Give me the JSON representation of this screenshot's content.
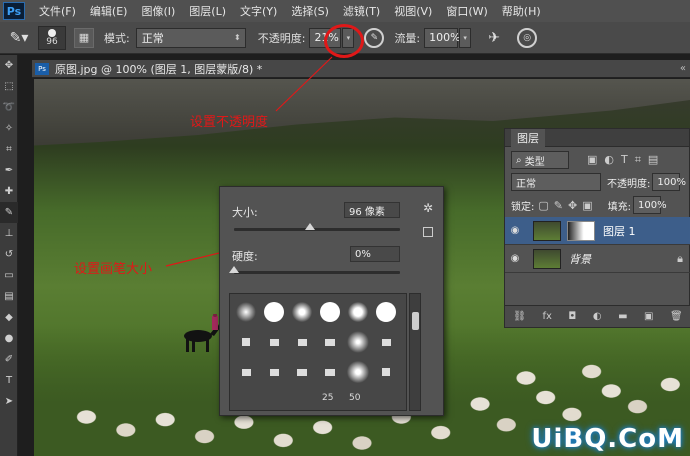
{
  "menu": {
    "logo": "Ps",
    "items": [
      "文件(F)",
      "编辑(E)",
      "图像(I)",
      "图层(L)",
      "文字(Y)",
      "选择(S)",
      "滤镜(T)",
      "视图(V)",
      "窗口(W)",
      "帮助(H)"
    ]
  },
  "options": {
    "brush_size": "96",
    "mode_label": "模式:",
    "mode_value": "正常",
    "opacity_label": "不透明度:",
    "opacity_value": "21%",
    "flow_label": "流量:",
    "flow_value": "100%"
  },
  "document": {
    "title": "原图.jpg @ 100% (图层 1, 图层蒙版/8) *"
  },
  "brush_popup": {
    "size_label": "大小:",
    "size_value": "96 像素",
    "hardness_label": "硬度:",
    "hardness_value": "0%",
    "size_level": 0.46,
    "hardness_level": 0.0,
    "labels": [
      "25",
      "50"
    ]
  },
  "annotations": {
    "opacity": "设置不透明度",
    "size": "设置画笔大小"
  },
  "layers_panel": {
    "tab": "图层",
    "filter_kind": "类型",
    "blend_mode": "正常",
    "opacity_label": "不透明度:",
    "opacity_value": "100%",
    "lock_label": "锁定:",
    "fill_label": "填充:",
    "fill_value": "100%",
    "layers": [
      {
        "name": "图层 1",
        "has_mask": true,
        "selected": true
      },
      {
        "name": "背景",
        "has_mask": false,
        "locked": true
      }
    ]
  },
  "watermark": "UiBQ.CoM"
}
